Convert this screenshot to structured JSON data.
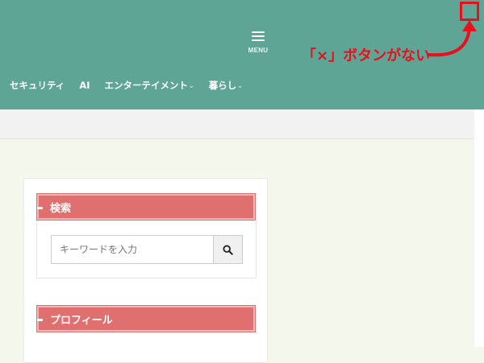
{
  "header": {
    "menu_label": "MENU",
    "bg_color": "#5fa595"
  },
  "nav": {
    "items": [
      {
        "label": "セキュリティ",
        "has_dropdown": false
      },
      {
        "label": "AI",
        "has_dropdown": false
      },
      {
        "label": "エンターテイメント",
        "has_dropdown": true
      },
      {
        "label": "暮らし",
        "has_dropdown": true
      }
    ]
  },
  "annotation": {
    "text": "「×」ボタンがない",
    "color": "#e8101c"
  },
  "sidebar": {
    "search_title": "検索",
    "search_placeholder": "キーワードを入力",
    "profile_title": "プロフィール",
    "widget_title_color": "#e07070"
  },
  "icons": {
    "menu": "hamburger-icon",
    "search": "search-icon",
    "dropdown": "chevron-down-icon"
  }
}
